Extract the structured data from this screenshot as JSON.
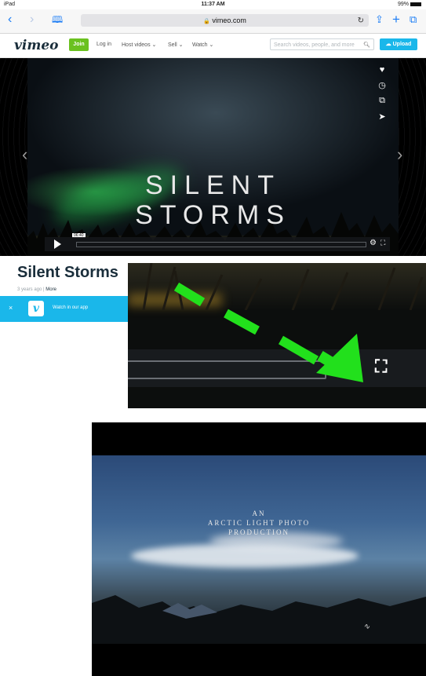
{
  "status": {
    "device": "iPad",
    "time": "11:37 AM",
    "battery": "99%"
  },
  "safari": {
    "url": "vimeo.com",
    "back_icon": "chevron-left",
    "forward_icon": "chevron-right",
    "bookmarks_icon": "book",
    "reload_icon": "reload",
    "share_icon": "share",
    "new_tab_icon": "plus",
    "tabs_icon": "tabs"
  },
  "vimeo_nav": {
    "logo": "vimeo",
    "join": "Join",
    "links": [
      "Log in",
      "Host videos",
      "Sell",
      "Watch"
    ],
    "search_placeholder": "Search videos, people, and more",
    "upload": "Upload"
  },
  "player": {
    "title_line1": "SILENT",
    "title_line2": "STORMS",
    "time_badge": "06:40",
    "side_icons": [
      "heart-icon",
      "clock-icon",
      "layers-icon",
      "send-icon"
    ]
  },
  "page": {
    "title": "Silent Storms",
    "age": "3 years ago",
    "separator": "|",
    "more": "More",
    "app_banner_close": "×",
    "app_banner_logo": "v",
    "app_banner_text": "Watch in our app"
  },
  "video_frame": {
    "credit_line1": "AN",
    "credit_line2": "ARCTIC LIGHT PHOTO",
    "credit_line3": "PRODUCTION"
  },
  "colors": {
    "vimeo_blue": "#1ab7ea",
    "join_green": "#6ac11f",
    "arrow_green": "#22e01c",
    "safari_blue": "#1a7cf5"
  }
}
